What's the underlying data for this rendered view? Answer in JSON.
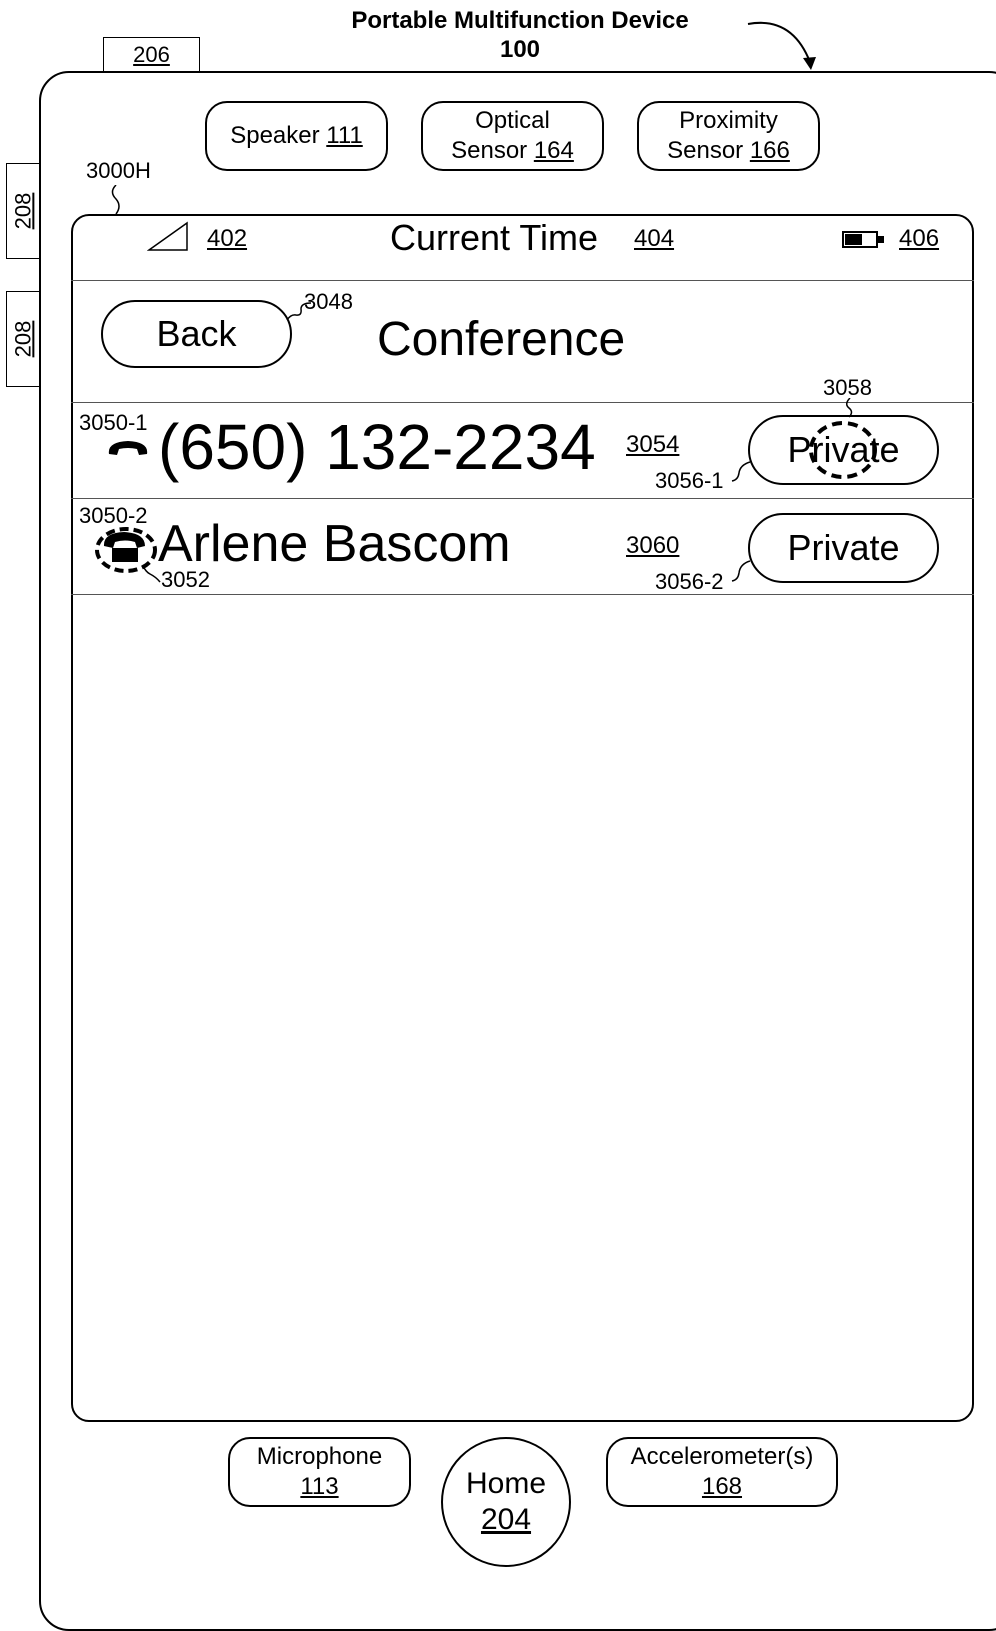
{
  "header": {
    "title": "Portable Multifunction Device",
    "device_ref": "100"
  },
  "side_labels": {
    "top": "206",
    "left_1": "208",
    "left_2": "208"
  },
  "sensors": {
    "speaker": {
      "label": "Speaker",
      "ref": "111"
    },
    "optical": {
      "line1": "Optical",
      "line2": "Sensor",
      "ref": "164"
    },
    "proximity": {
      "line1": "Proximity",
      "line2": "Sensor",
      "ref": "166"
    }
  },
  "screen_ref": "3000H",
  "status_bar": {
    "signal_ref": "402",
    "time": "Current Time",
    "time_ref": "404",
    "battery_ref": "406"
  },
  "nav": {
    "back": "Back",
    "back_ref": "3048",
    "title": "Conference"
  },
  "calls": [
    {
      "id_ref": "3050-1",
      "name": "(650) 132-2234",
      "name_ref": "3054",
      "private_label": "Private",
      "private_ref": "3056-1",
      "highlight_ref": "3058"
    },
    {
      "id_ref": "3050-2",
      "name": "Arlene Bascom",
      "name_ref": "3060",
      "private_label": "Private",
      "private_ref": "3056-2",
      "icon_ref": "3052"
    }
  ],
  "hardware": {
    "microphone": {
      "label": "Microphone",
      "ref": "113"
    },
    "home": {
      "label": "Home",
      "ref": "204"
    },
    "accelerometer": {
      "label": "Accelerometer(s)",
      "ref": "168"
    }
  }
}
